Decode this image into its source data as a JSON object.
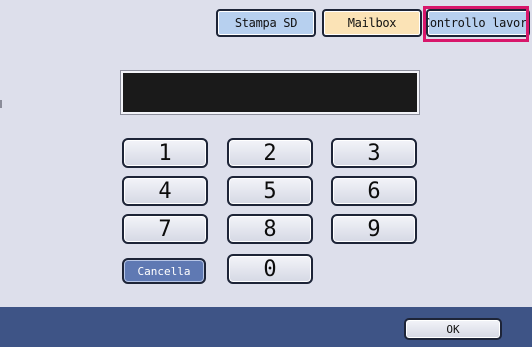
{
  "tabs": {
    "stampa_sd": "Stampa SD",
    "mailbox": "Mailbox",
    "controllo_lavori": "Controllo lavori"
  },
  "display": {
    "value": ""
  },
  "keypad": {
    "keys": [
      "1",
      "2",
      "3",
      "4",
      "5",
      "6",
      "7",
      "8",
      "9",
      "0"
    ],
    "cancel_label": "Cancella"
  },
  "footer": {
    "ok_label": "OK"
  },
  "colors": {
    "background": "#dddfeb",
    "tab_blue": "#b7d0ef",
    "tab_orange": "#fbe3b6",
    "highlight": "#d8176b",
    "bottom_bar": "#3e5486",
    "cancel_button": "#5f79b3"
  }
}
